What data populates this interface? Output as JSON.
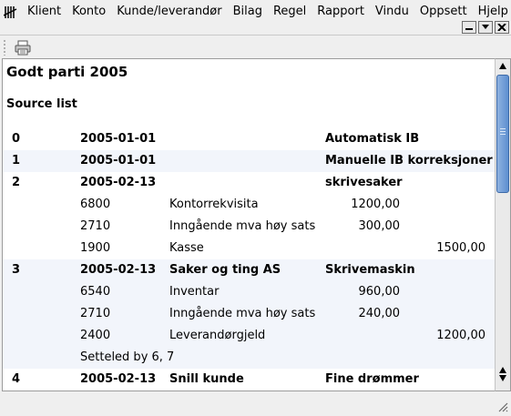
{
  "menubar": {
    "app_icon": "tally-marks-icon",
    "items": [
      "Klient",
      "Konto",
      "Kunde/leverandør",
      "Bilag",
      "Regel",
      "Rapport",
      "Vindu",
      "Oppsett",
      "Hjelp"
    ]
  },
  "window_controls": [
    "minimize-icon",
    "restore-icon",
    "close-icon"
  ],
  "toolbar": {
    "print_icon": "printer-icon"
  },
  "document": {
    "title": "Godt parti 2005",
    "subtitle": "Source list",
    "rows": [
      {
        "type": "entry",
        "id": "0",
        "date": "2005-01-01",
        "name": "",
        "desc": "Automatisk IB"
      },
      {
        "type": "entry",
        "id": "1",
        "date": "2005-01-01",
        "name": "",
        "desc": "Manuelle IB korreksjoner"
      },
      {
        "type": "entry",
        "id": "2",
        "date": "2005-02-13",
        "name": "",
        "desc": "skrivesaker"
      },
      {
        "type": "line",
        "account": "6800",
        "account_name": "Kontorrekvisita",
        "debit": "1200,00",
        "credit": ""
      },
      {
        "type": "line",
        "account": "2710",
        "account_name": "Inngående mva høy sats",
        "debit": "300,00",
        "credit": ""
      },
      {
        "type": "line",
        "account": "1900",
        "account_name": "Kasse",
        "debit": "",
        "credit": "1500,00"
      },
      {
        "type": "entry",
        "id": "3",
        "date": "2005-02-13",
        "name": "Saker og ting AS",
        "desc": "Skrivemaskin"
      },
      {
        "type": "line",
        "account": "6540",
        "account_name": "Inventar",
        "debit": "960,00",
        "credit": ""
      },
      {
        "type": "line",
        "account": "2710",
        "account_name": "Inngående mva høy sats",
        "debit": "240,00",
        "credit": ""
      },
      {
        "type": "line",
        "account": "2400",
        "account_name": "Leverandørgjeld",
        "debit": "",
        "credit": "1200,00"
      },
      {
        "type": "note",
        "text": "Setteled by 6, 7"
      },
      {
        "type": "entry",
        "id": "4",
        "date": "2005-02-13",
        "name": "Snill kunde",
        "desc": "Fine drømmer"
      }
    ]
  },
  "colors": {
    "background": "#efefef",
    "content_bg": "#ffffff",
    "row_shade": "#f2f5fb",
    "scroll_thumb": "#5d8fd0"
  }
}
